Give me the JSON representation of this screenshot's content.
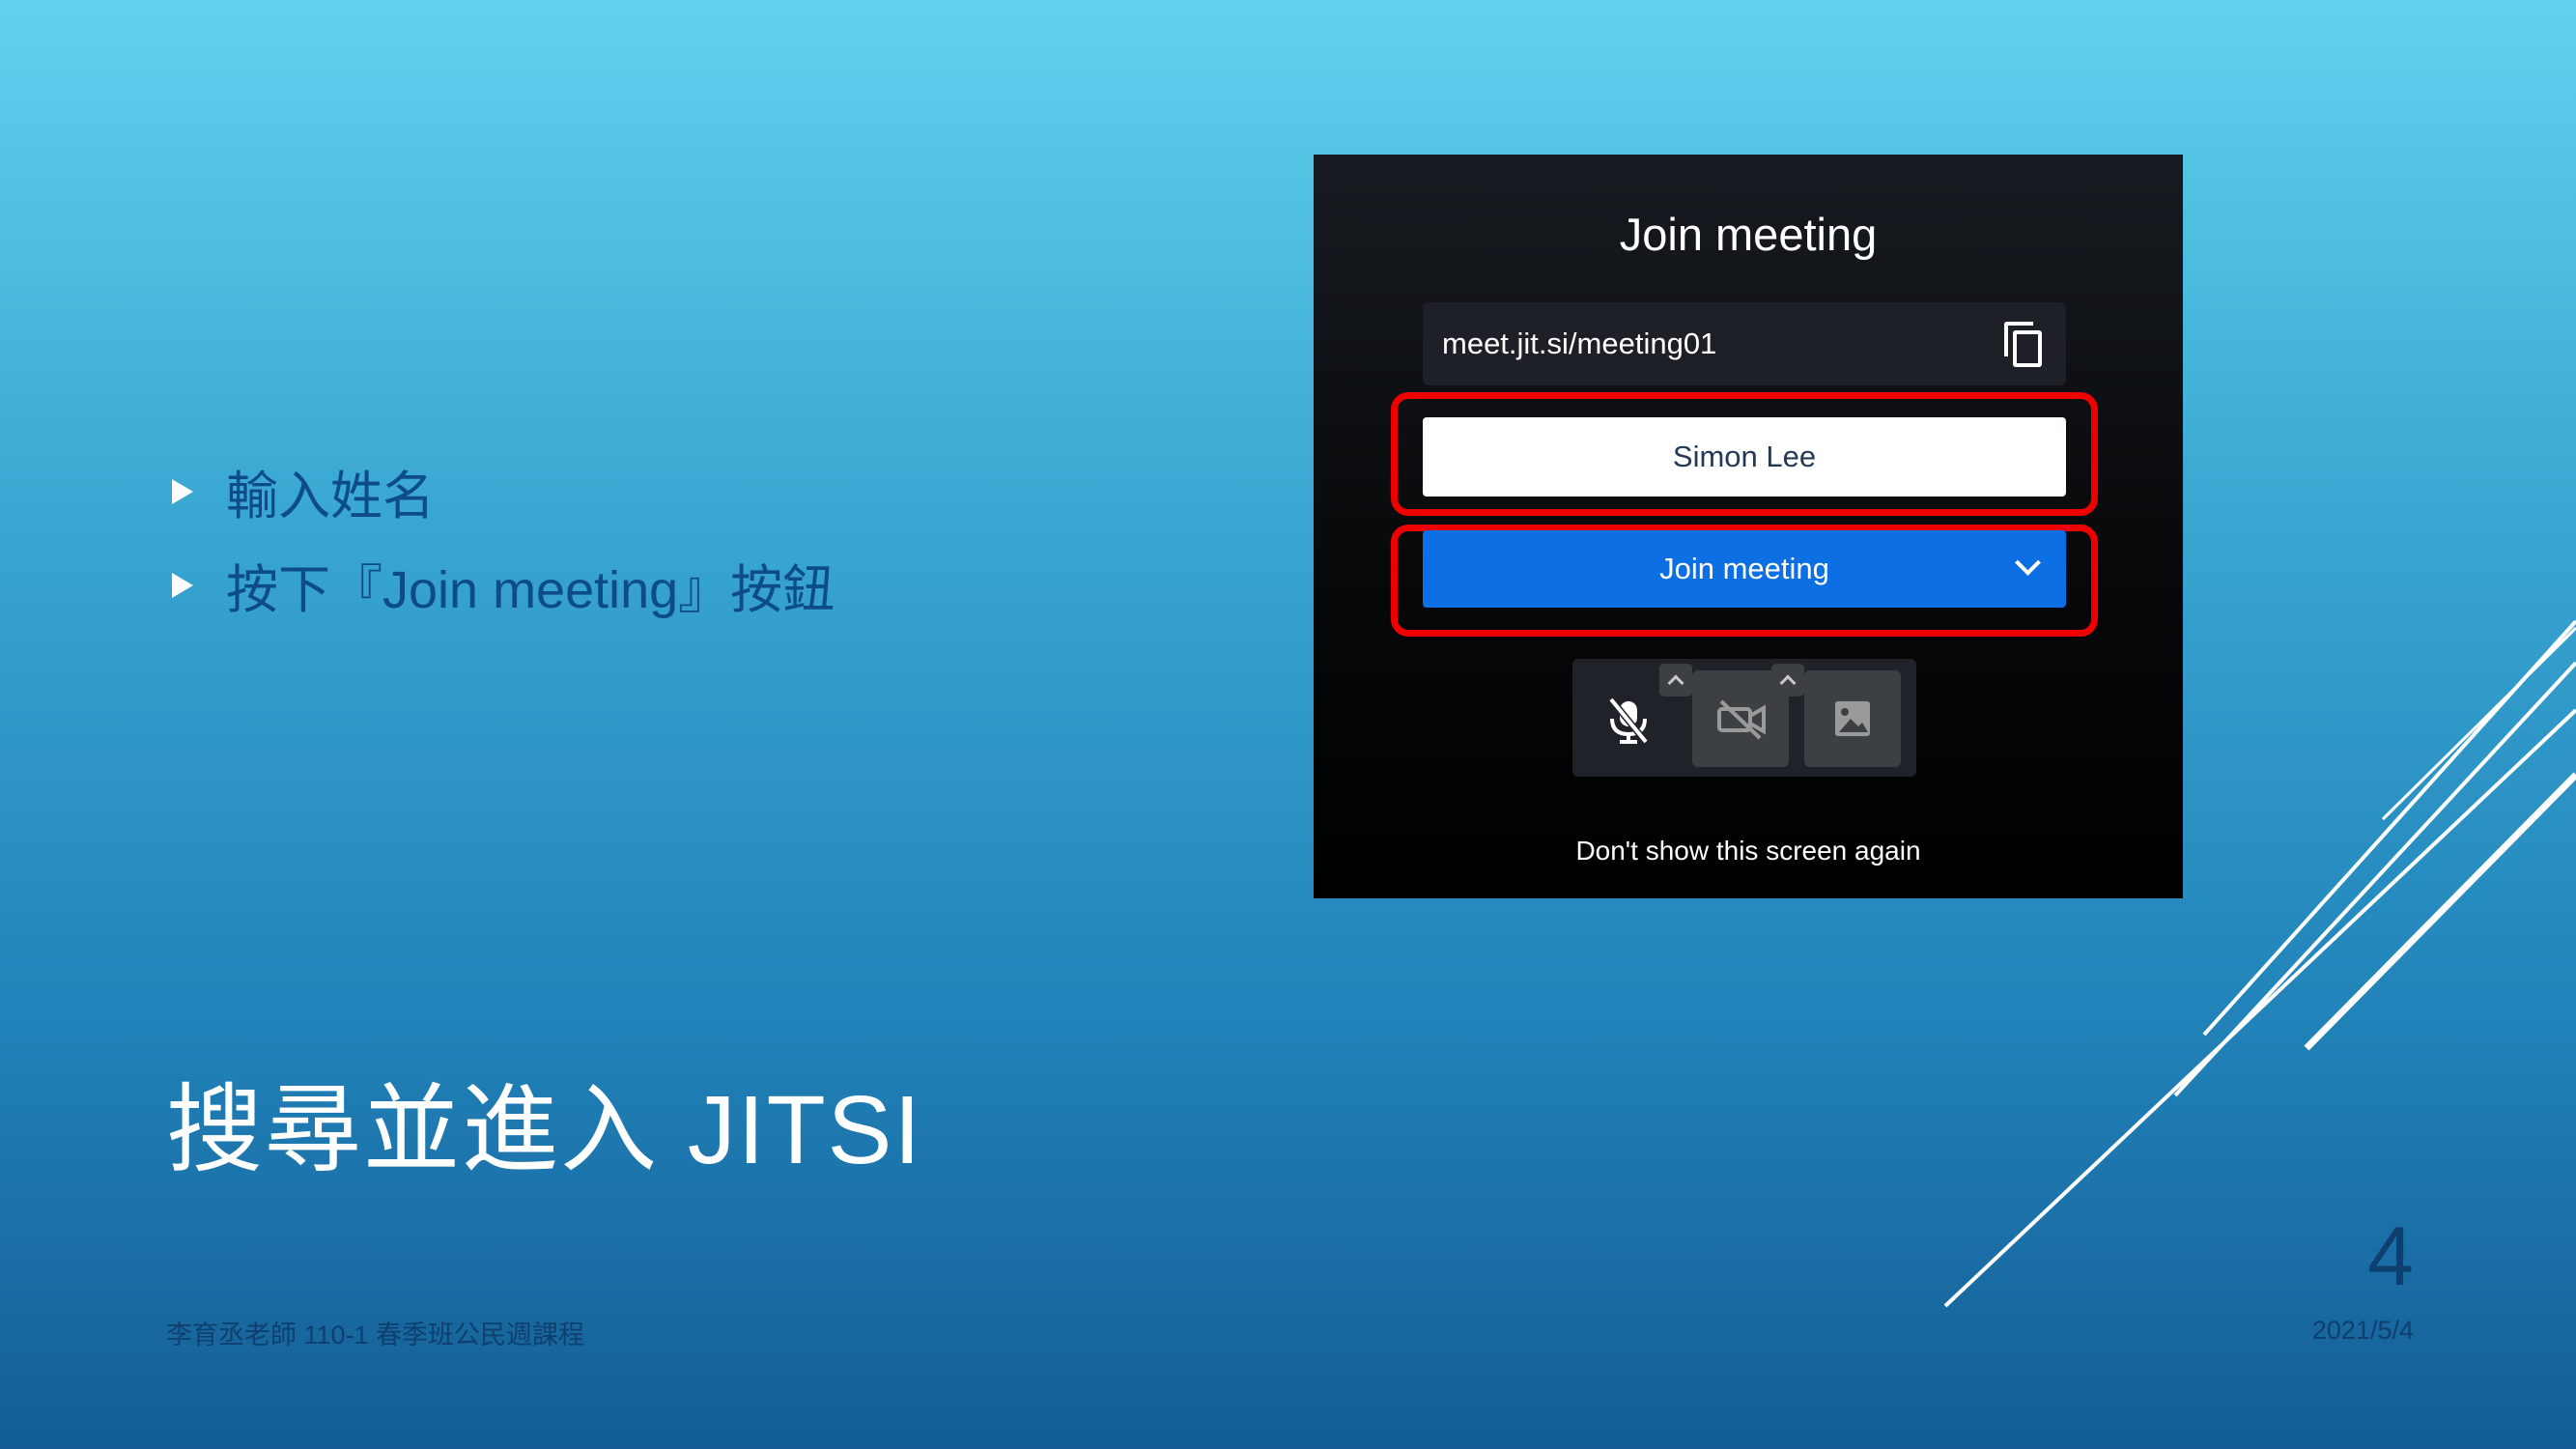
{
  "slide": {
    "bullets": [
      "輸入姓名",
      "按下『Join meeting』按鈕"
    ],
    "title": "搜尋並進入 JITSI",
    "footer_text": "李育丞老師 110-1 春季班公民週課程",
    "date": "2021/5/4",
    "slide_number": "4"
  },
  "dialog": {
    "title": "Join meeting",
    "meeting_url": "meet.jit.si/meeting01",
    "name_value": "Simon Lee",
    "join_button_label": "Join meeting",
    "dont_show_label": "Don't show this screen again",
    "icons": [
      "copy-icon",
      "chevron-down-icon",
      "microphone-muted-icon",
      "camera-off-icon",
      "background-icon"
    ]
  },
  "colors": {
    "join_button": "#0c6fe3",
    "highlight": "#ef0000",
    "bullet_text": "#0d4c86"
  }
}
